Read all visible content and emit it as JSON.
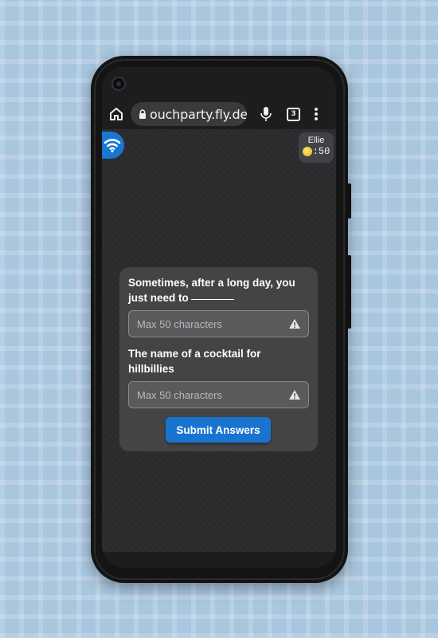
{
  "browser": {
    "url": "ouchparty.fly.dev",
    "tab_count": "3",
    "icons": [
      "home-icon",
      "lock-icon",
      "microphone-icon",
      "tabs-icon",
      "more-vert-icon"
    ]
  },
  "header": {
    "connection_icon": "wifi-icon",
    "player": {
      "name": "Ellie",
      "coins": ":50",
      "coin_icon": "coin-icon"
    }
  },
  "prompts": [
    {
      "text": "Sometimes, after a long day, you just need to",
      "has_blank": true,
      "placeholder": "Max 50 characters",
      "value": ""
    },
    {
      "text": "The name of a cocktail for hillbillies",
      "has_blank": false,
      "placeholder": "Max 50 characters",
      "value": ""
    }
  ],
  "submit_label": "Submit Answers",
  "colors": {
    "accent": "#1874cf",
    "card": "#444447",
    "background": "#2c2c2e",
    "page_background": "#a9c6df"
  }
}
